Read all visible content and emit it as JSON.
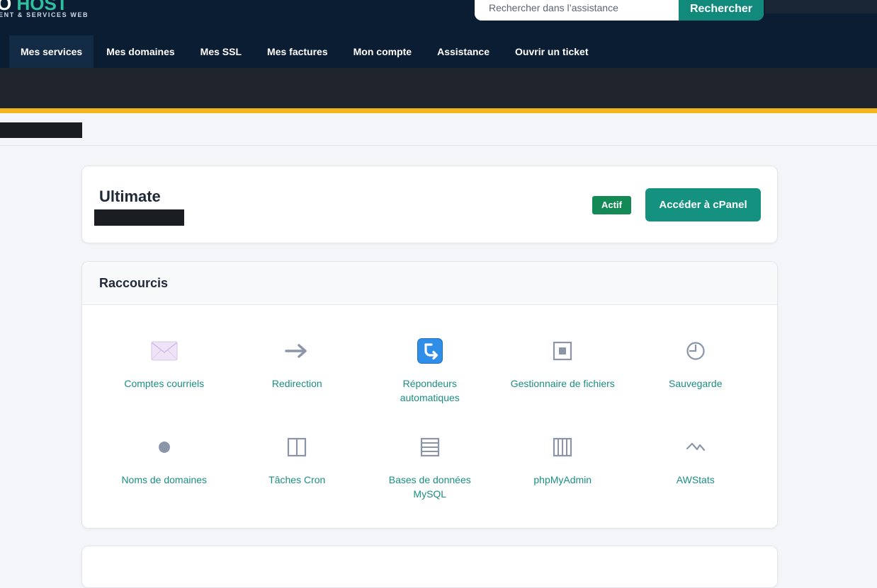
{
  "header": {
    "logo_left": "O",
    "logo_right": "HOST",
    "tagline": "ENT & SERVICES WEB",
    "search_placeholder": "Rechercher dans l’assistance",
    "search_button": "Rechercher",
    "accent_color": "#14917f"
  },
  "nav": {
    "items": [
      {
        "label": "Mes services"
      },
      {
        "label": "Mes domaines"
      },
      {
        "label": "Mes SSL"
      },
      {
        "label": "Mes factures"
      },
      {
        "label": "Mon compte"
      },
      {
        "label": "Assistance"
      },
      {
        "label": "Ouvrir un ticket"
      }
    ]
  },
  "service": {
    "title": "Ultimate",
    "status": "Actif",
    "cpanel_button": "Accéder à cPanel"
  },
  "shortcuts": {
    "title": "Raccourcis",
    "items": [
      {
        "label": "Comptes courriels",
        "icon": "envelope-icon"
      },
      {
        "label": "Redirection",
        "icon": "arrow-right-icon"
      },
      {
        "label": "Répondeurs automatiques",
        "icon": "autoresponder-icon"
      },
      {
        "label": "Gestionnaire de fichiers",
        "icon": "file-manager-icon"
      },
      {
        "label": "Sauvegarde",
        "icon": "clock-icon"
      },
      {
        "label": "Noms de domaines",
        "icon": "dot-icon"
      },
      {
        "label": "Tâches Cron",
        "icon": "columns-icon"
      },
      {
        "label": "Bases de données MySQL",
        "icon": "database-icon"
      },
      {
        "label": "phpMyAdmin",
        "icon": "bars-icon"
      },
      {
        "label": "AWStats",
        "icon": "stats-icon"
      }
    ]
  }
}
